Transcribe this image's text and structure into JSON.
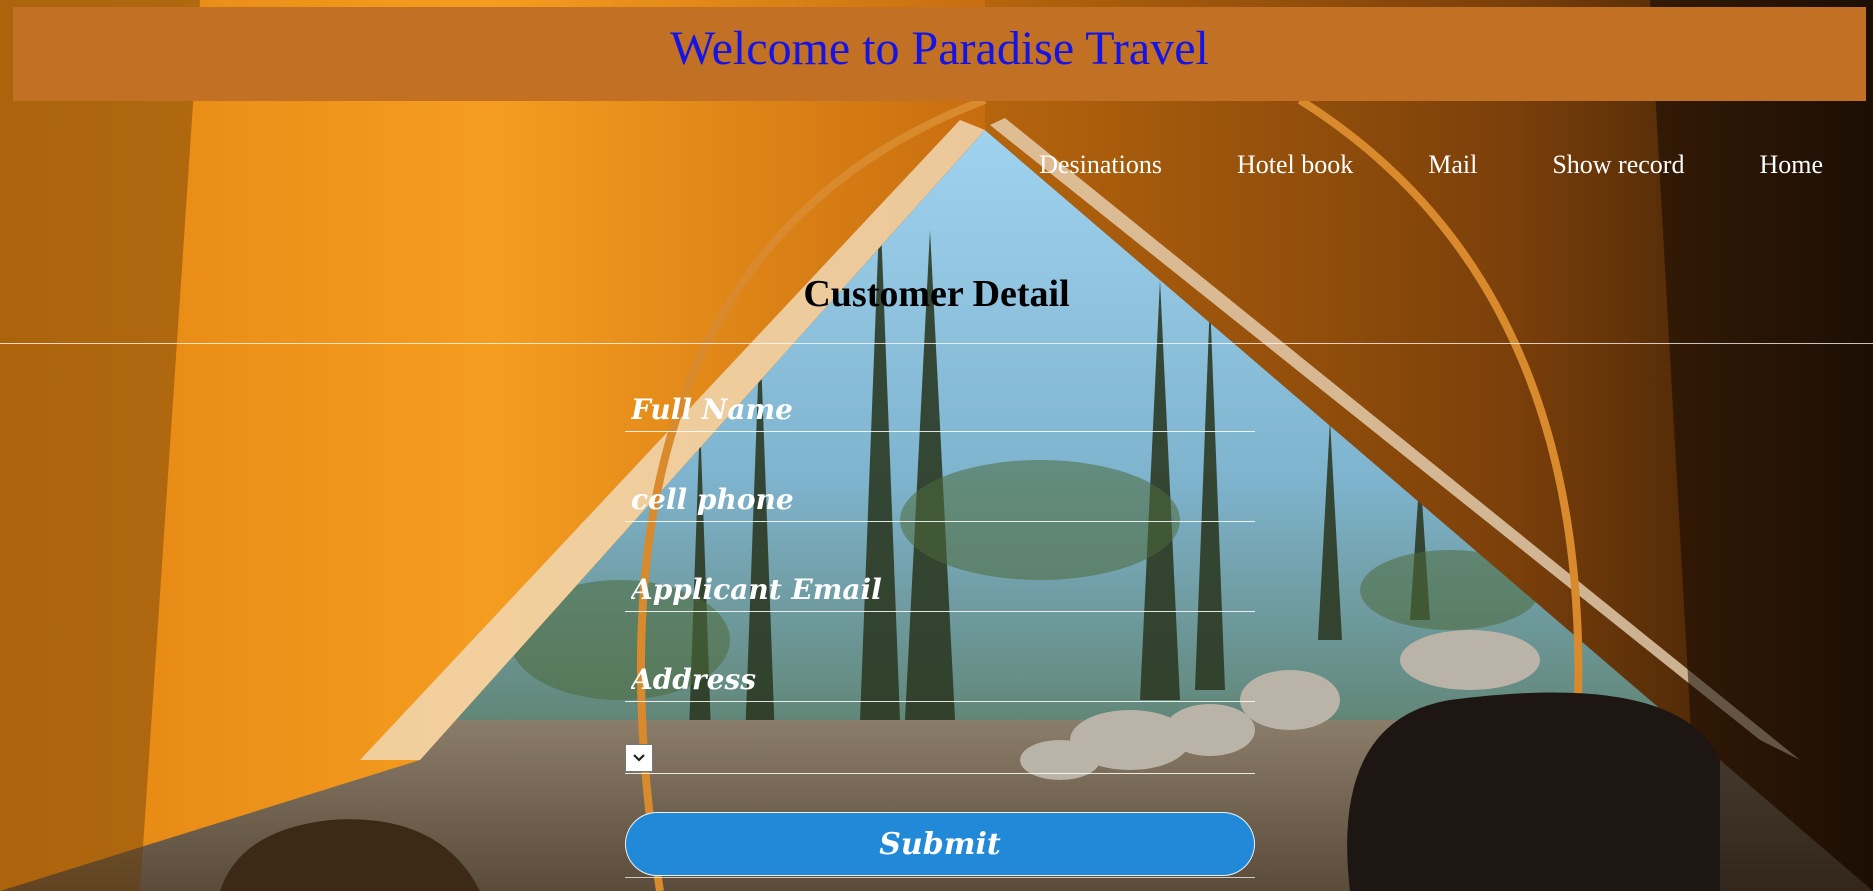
{
  "header": {
    "title": "Welcome to Paradise Travel"
  },
  "nav": {
    "items": [
      {
        "label": "Desinations"
      },
      {
        "label": "Hotel book"
      },
      {
        "label": "Mail"
      },
      {
        "label": "Show record"
      },
      {
        "label": "Home"
      }
    ]
  },
  "form": {
    "title": "Customer Detail",
    "full_name": {
      "placeholder": "Full Name",
      "value": ""
    },
    "cell_phone": {
      "placeholder": "cell phone",
      "value": ""
    },
    "email": {
      "placeholder": "Applicant Email",
      "value": ""
    },
    "address": {
      "placeholder": "Address",
      "value": ""
    },
    "select": {
      "selected": ""
    },
    "submit_label": "Submit"
  },
  "colors": {
    "banner": "#c27024",
    "title_text": "#1414e6",
    "submit_button": "#2289d9"
  },
  "icons": {
    "select_arrow": "chevron-down-icon"
  }
}
